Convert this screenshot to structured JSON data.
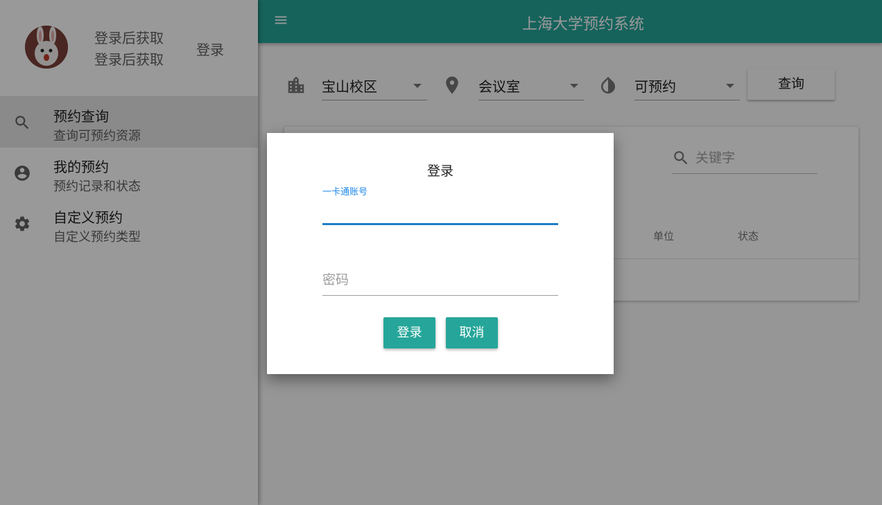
{
  "app": {
    "title": "上海大学预约系统"
  },
  "profile": {
    "line1": "登录后获取",
    "line2": "登录后获取",
    "login_label": "登录"
  },
  "sidebar": {
    "items": [
      {
        "title": "预约查询",
        "subtitle": "查询可预约资源",
        "icon": "search-icon",
        "active": true
      },
      {
        "title": "我的预约",
        "subtitle": "预约记录和状态",
        "icon": "account-circle-icon",
        "active": false
      },
      {
        "title": "自定义预约",
        "subtitle": "自定义预约类型",
        "icon": "gear-icon",
        "active": false
      }
    ]
  },
  "filters": {
    "campus": {
      "value": "宝山校区",
      "icon": "building-icon"
    },
    "type": {
      "value": "会议室",
      "icon": "location-pin-icon"
    },
    "status": {
      "value": "可预约",
      "icon": "contrast-drop-icon"
    },
    "query_label": "查询"
  },
  "table": {
    "search_placeholder": "关键字",
    "columns": [
      "单位",
      "状态"
    ]
  },
  "dialog": {
    "title": "登录",
    "account_label": "一卡通账号",
    "account_value": "",
    "password_placeholder": "密码",
    "login_label": "登录",
    "cancel_label": "取消"
  },
  "colors": {
    "primary": "#26a69a",
    "focus": "#1e7fc4"
  }
}
